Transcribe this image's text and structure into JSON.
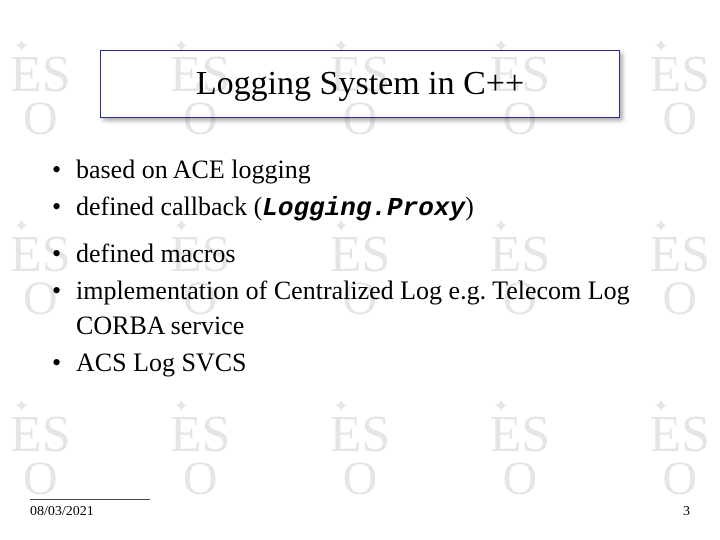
{
  "title": "Logging System in C++",
  "bullets": [
    {
      "pre": "based on ACE logging",
      "code": "",
      "post": ""
    },
    {
      "pre": "defined callback (",
      "code": "Logging.Proxy",
      "post": ")"
    },
    {
      "pre": "defined macros",
      "code": "",
      "post": ""
    },
    {
      "pre": "implementation of Centralized Log e.g. Telecom Log CORBA service",
      "code": "",
      "post": ""
    },
    {
      "pre": "ACS Log SVCS",
      "code": "",
      "post": ""
    }
  ],
  "footer": {
    "date": "08/03/2021",
    "page": "3"
  },
  "watermark": {
    "es": "ES",
    "o": "O",
    "star": "✦"
  }
}
